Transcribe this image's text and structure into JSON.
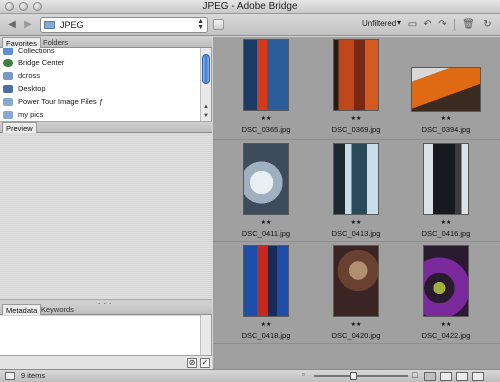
{
  "window": {
    "title": "JPEG - Adobe Bridge"
  },
  "toolbar": {
    "path_label": "JPEG",
    "filter_label": "Unfiltered",
    "back_icon": "back-arrow-icon",
    "forward_icon": "forward-arrow-icon"
  },
  "left_panel": {
    "tabs_top": [
      {
        "label": "Favorites"
      },
      {
        "label": "Folders"
      }
    ],
    "favorites": [
      {
        "label": "Collections",
        "icon": "collections-icon",
        "color": "#5e8fd0"
      },
      {
        "label": "Bridge Center",
        "icon": "bridge-center-icon",
        "color": "#3f7f3f"
      },
      {
        "label": "dcross",
        "icon": "home-folder-icon",
        "color": "#7a9bc7"
      },
      {
        "label": "Desktop",
        "icon": "desktop-icon",
        "color": "#4b6fa3"
      },
      {
        "label": "Power Tour Image Files",
        "icon": "folder-icon",
        "color": "#8aa9d1",
        "badge": "ƒ"
      },
      {
        "label": "my pics",
        "icon": "folder-icon",
        "color": "#8aa9d1"
      }
    ],
    "preview_tab": "Preview",
    "tabs_bottom": [
      {
        "label": "Metadata"
      },
      {
        "label": "Keywords"
      }
    ]
  },
  "thumbnails": [
    {
      "name": "DSC_0365.jpg",
      "rating": "★★",
      "colors": [
        "#1c3a66",
        "#d23a1c",
        "#2b5d9a"
      ]
    },
    {
      "name": "DSC_0369.jpg",
      "rating": "★★",
      "colors": [
        "#7a2a12",
        "#c0461c",
        "#2a1a14"
      ]
    },
    {
      "name": "DSC_0394.jpg",
      "rating": "★★",
      "colors": [
        "#e06a14",
        "#3a2a20",
        "#d8d8d8"
      ]
    },
    {
      "name": "DSC_0411.jpg",
      "rating": "★★",
      "colors": [
        "#9fb0c0",
        "#e8eef2",
        "#3c4c5c"
      ]
    },
    {
      "name": "DSC_0413.jpg",
      "rating": "★★",
      "colors": [
        "#2a4a5a",
        "#c8dde8",
        "#1a2a30"
      ]
    },
    {
      "name": "DSC_0416.jpg",
      "rating": "★★",
      "colors": [
        "#161a20",
        "#dce2e6",
        "#3a3a40"
      ]
    },
    {
      "name": "DSC_0418.jpg",
      "rating": "★★",
      "colors": [
        "#1d4fa8",
        "#c8281c",
        "#1a2a5a"
      ]
    },
    {
      "name": "DSC_0420.jpg",
      "rating": "★★",
      "colors": [
        "#3a2424",
        "#6a4030",
        "#b09070"
      ]
    },
    {
      "name": "DSC_0422.jpg",
      "rating": "★★",
      "colors": [
        "#7a2a9c",
        "#2a1a30",
        "#a0b040"
      ]
    }
  ],
  "status": {
    "count_text": "9 items"
  },
  "colors": {
    "content_bg": "#a0a0a0",
    "scroll_accent": "#3c7bd4"
  }
}
